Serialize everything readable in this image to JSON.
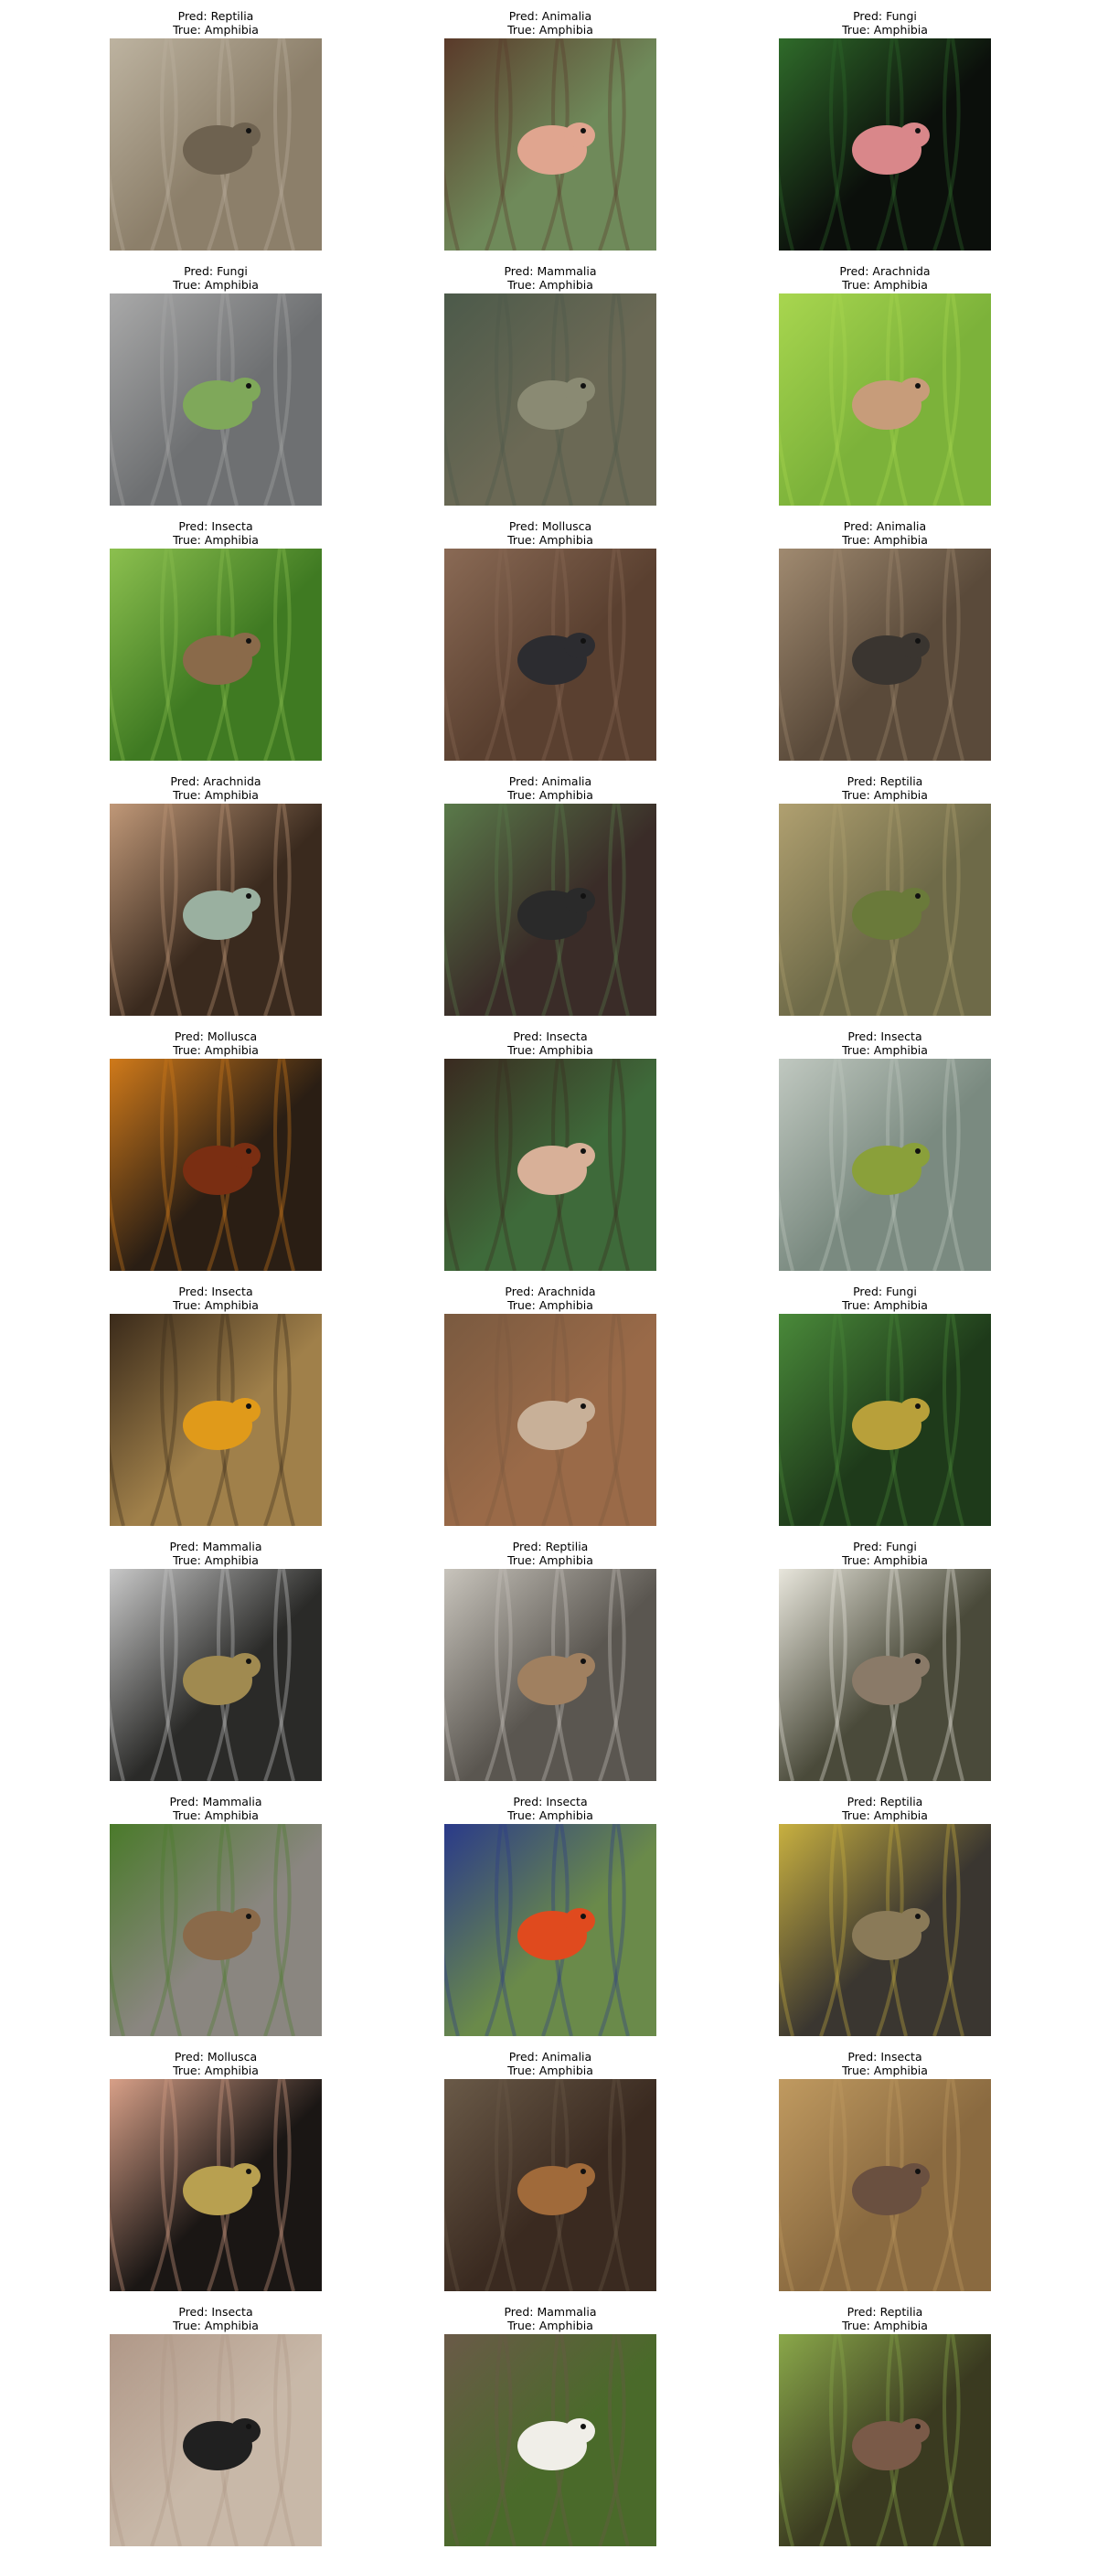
{
  "cells": [
    {
      "pred": "Pred: Reptilia",
      "true": "True: Amphibia",
      "image": "frog-in-dry-grass",
      "bg": "#8c7f6a",
      "fg": "#6e6250",
      "accent": "#bdb3a0"
    },
    {
      "pred": "Pred: Animalia",
      "true": "True: Amphibia",
      "image": "frog-on-hand-selfie",
      "bg": "#6f8a5a",
      "fg": "#e0a58f",
      "accent": "#5a3a2a"
    },
    {
      "pred": "Pred: Fungi",
      "true": "True: Amphibia",
      "image": "pink-frog-on-leaf",
      "bg": "#0b0f0b",
      "fg": "#d9878a",
      "accent": "#2f6b2a"
    },
    {
      "pred": "Pred: Fungi",
      "true": "True: Amphibia",
      "image": "green-frog-on-pebbles",
      "bg": "#6e7072",
      "fg": "#7fa85a",
      "accent": "#a9a9a9"
    },
    {
      "pred": "Pred: Mammalia",
      "true": "True: Amphibia",
      "image": "frog-in-stream",
      "bg": "#6b6955",
      "fg": "#8a8a73",
      "accent": "#4c5a4a"
    },
    {
      "pred": "Pred: Arachnida",
      "true": "True: Amphibia",
      "image": "frog-in-green-grass",
      "bg": "#7cb23a",
      "fg": "#c79c7a",
      "accent": "#a8d64f"
    },
    {
      "pred": "Pred: Insecta",
      "true": "True: Amphibia",
      "image": "frog-among-leaves",
      "bg": "#3f7a22",
      "fg": "#8a6a4a",
      "accent": "#8cc04f"
    },
    {
      "pred": "Pred: Mollusca",
      "true": "True: Amphibia",
      "image": "salamander-on-bark",
      "bg": "#5a4030",
      "fg": "#2c2c30",
      "accent": "#8a6a55"
    },
    {
      "pred": "Pred: Animalia",
      "true": "True: Amphibia",
      "image": "newt-on-dead-leaves",
      "bg": "#5a4a3a",
      "fg": "#3a3530",
      "accent": "#a08a70"
    },
    {
      "pred": "Pred: Arachnida",
      "true": "True: Amphibia",
      "image": "frog-at-night-ground",
      "bg": "#3a2a1e",
      "fg": "#9ab0a0",
      "accent": "#c09878"
    },
    {
      "pred": "Pred: Animalia",
      "true": "True: Amphibia",
      "image": "toad-in-dark-leaves",
      "bg": "#3a2c28",
      "fg": "#2a2a2a",
      "accent": "#5a7a4a"
    },
    {
      "pred": "Pred: Reptilia",
      "true": "True: Amphibia",
      "image": "frog-in-straw",
      "bg": "#6e6a48",
      "fg": "#6a7a3a",
      "accent": "#b0a070"
    },
    {
      "pred": "Pred: Mollusca",
      "true": "True: Amphibia",
      "image": "red-newt-on-leaves",
      "bg": "#2a1e14",
      "fg": "#7a2e12",
      "accent": "#d07a1a"
    },
    {
      "pred": "Pred: Insecta",
      "true": "True: Amphibia",
      "image": "toad-on-fingers",
      "bg": "#3e6a3a",
      "fg": "#d8b098",
      "accent": "#3a2a20"
    },
    {
      "pred": "Pred: Insecta",
      "true": "True: Amphibia",
      "image": "bullfrog-in-water",
      "bg": "#7a8a80",
      "fg": "#8aa03a",
      "accent": "#c0c8c0"
    },
    {
      "pred": "Pred: Insecta",
      "true": "True: Amphibia",
      "image": "orange-newt-closeup",
      "bg": "#a0804a",
      "fg": "#e09a1a",
      "accent": "#3a2a1a"
    },
    {
      "pred": "Pred: Arachnida",
      "true": "True: Amphibia",
      "image": "toad-on-sand",
      "bg": "#9a6a48",
      "fg": "#c8b098",
      "accent": "#7a5a40"
    },
    {
      "pred": "Pred: Fungi",
      "true": "True: Amphibia",
      "image": "yellow-frog-in-leaves",
      "bg": "#1e3a1a",
      "fg": "#b8a03a",
      "accent": "#4a8a3a"
    },
    {
      "pred": "Pred: Mammalia",
      "true": "True: Amphibia",
      "image": "toad-under-rock",
      "bg": "#2a2a28",
      "fg": "#a08a50",
      "accent": "#c8c8c8"
    },
    {
      "pred": "Pred: Reptilia",
      "true": "True: Amphibia",
      "image": "frog-on-metal-grate",
      "bg": "#5a5650",
      "fg": "#a08060",
      "accent": "#c8c4bc"
    },
    {
      "pred": "Pred: Fungi",
      "true": "True: Amphibia",
      "image": "frog-beside-wall",
      "bg": "#4a4a3a",
      "fg": "#8a7a68",
      "accent": "#e8e6dc"
    },
    {
      "pred": "Pred: Mammalia",
      "true": "True: Amphibia",
      "image": "toad-on-log",
      "bg": "#8a8680",
      "fg": "#8a6a4a",
      "accent": "#4a7a2a"
    },
    {
      "pred": "Pred: Insecta",
      "true": "True: Amphibia",
      "image": "poison-dart-frog",
      "bg": "#6a8a4a",
      "fg": "#e04a1e",
      "accent": "#2a3a8a"
    },
    {
      "pred": "Pred: Reptilia",
      "true": "True: Amphibia",
      "image": "toad-on-dark-ground",
      "bg": "#3a3630",
      "fg": "#8a7a58",
      "accent": "#c8b040"
    },
    {
      "pred": "Pred: Mollusca",
      "true": "True: Amphibia",
      "image": "toad-on-palm",
      "bg": "#1a1614",
      "fg": "#b8a050",
      "accent": "#d8a088"
    },
    {
      "pred": "Pred: Animalia",
      "true": "True: Amphibia",
      "image": "salamander-in-soil",
      "bg": "#3a2a20",
      "fg": "#a06a3a",
      "accent": "#6a5a48"
    },
    {
      "pred": "Pred: Insecta",
      "true": "True: Amphibia",
      "image": "frog-on-wood",
      "bg": "#8a6a40",
      "fg": "#6a5040",
      "accent": "#c09a60"
    },
    {
      "pred": "Pred: Insecta",
      "true": "True: Amphibia",
      "image": "black-salamander-on-hand",
      "bg": "#c8b8a8",
      "fg": "#202020",
      "accent": "#b09888"
    },
    {
      "pred": "Pred: Mammalia",
      "true": "True: Amphibia",
      "image": "frog-in-paper-cup",
      "bg": "#4a6a2a",
      "fg": "#f0eee8",
      "accent": "#6a5a48"
    },
    {
      "pred": "Pred: Reptilia",
      "true": "True: Amphibia",
      "image": "frog-on-mossy-ground",
      "bg": "#3a3a20",
      "fg": "#7a5a48",
      "accent": "#8aa84a"
    }
  ]
}
